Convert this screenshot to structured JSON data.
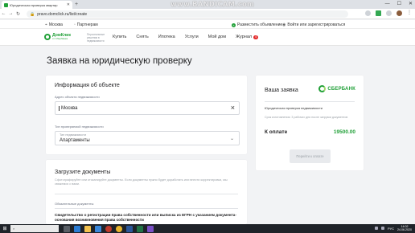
{
  "browser": {
    "tab_title": "Юридическая проверка квартир",
    "url": "pravo.domclick.ru/list/create",
    "window_controls": [
      "—",
      "☐",
      "✕"
    ],
    "bookmarks": [
      "Москва",
      "Партнерам"
    ]
  },
  "watermark": "www.BANDICAM.com",
  "site_top": {
    "city": "Москва",
    "partners": "Партнерам",
    "place_ad": "Разместить объявление",
    "login": "Войти или зарегистрироваться"
  },
  "header": {
    "logo_name": "ДомКлик",
    "logo_sub": "от Сбербанка",
    "tagline": "Персональные решения в недвижимости",
    "menu": [
      {
        "label": "Купить"
      },
      {
        "label": "Снять"
      },
      {
        "label": "Ипотека"
      },
      {
        "label": "Услуги"
      },
      {
        "label": "Мой дом"
      },
      {
        "label": "Журнал",
        "badge": "4"
      }
    ]
  },
  "page": {
    "title": "Заявка на юридическую проверку"
  },
  "object_info": {
    "heading": "Информация об объекте",
    "address_label": "Адрес объекта недвижимости",
    "address_value": "Москва",
    "type_label": "Тип проверяемой недвижимости",
    "type_inner_label": "Тип недвижимости",
    "type_value": "Апартаменты"
  },
  "documents": {
    "heading": "Загрузите документы",
    "description": "Сфотографируйте или отсканируйте документы. Если документы нужно будет доработать или внести корректировки, мы свяжемся с вами.",
    "required_label": "Обязательные документы",
    "first_doc": "Свидетельство о регистрации права собственности или выписка из ЕГРН с указанием документа-основания возникновения права собственности"
  },
  "order": {
    "heading": "Ваша заявка",
    "bank_name": "СБЕРБАНК",
    "line_item": "Юридическая проверка недвижимости",
    "note": "Срок изготовления: 3 рабочих дня после загрузки документов",
    "total_label": "К оплате",
    "total_value": "19500.00",
    "pay_button": "Перейти к оплате"
  },
  "taskbar": {
    "search_placeholder": "",
    "lang": "РУС",
    "time": "14:02",
    "date": "24.06.2020"
  },
  "colors": {
    "brand_green": "#21a038",
    "page_bg": "#f2f3f5",
    "badge_red": "#e32c2c"
  }
}
